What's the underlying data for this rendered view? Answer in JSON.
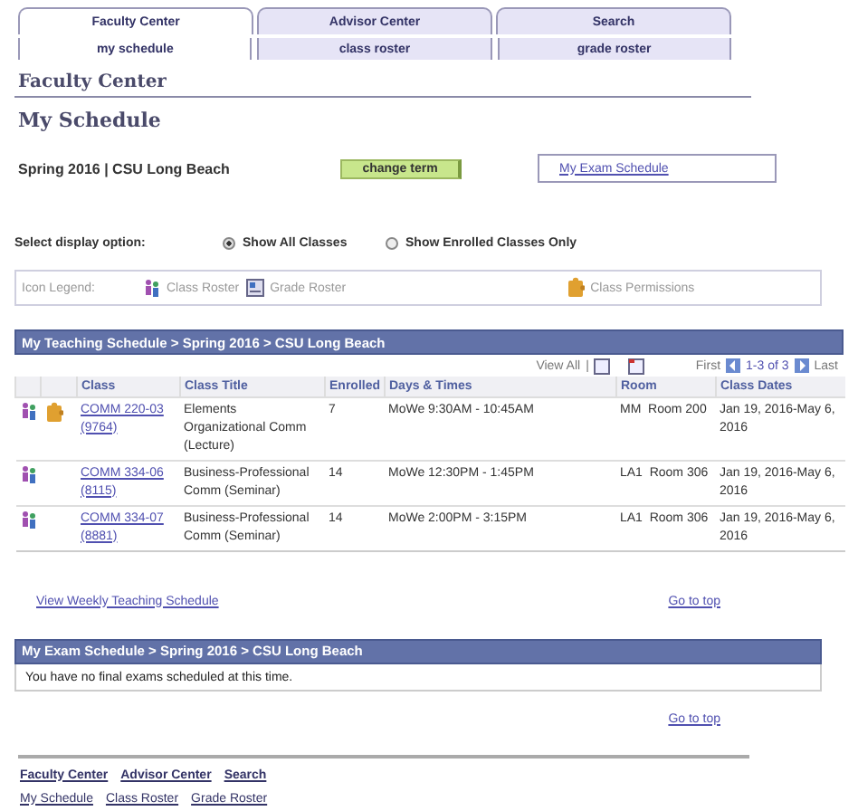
{
  "tabs": [
    {
      "label": "Faculty Center",
      "selected": true
    },
    {
      "label": "Advisor Center",
      "selected": false
    },
    {
      "label": "Search",
      "selected": false
    }
  ],
  "subtabs": [
    {
      "label": "my schedule",
      "selected": true
    },
    {
      "label": "class roster",
      "selected": false
    },
    {
      "label": "grade roster",
      "selected": false
    }
  ],
  "page_heading": "Faculty Center",
  "title": "My Schedule",
  "term": "Spring 2016 | CSU Long Beach",
  "change_term_button": "change term",
  "exam_schedule_link": "My Exam Schedule",
  "display_option": {
    "label": "Select display option:",
    "options": [
      {
        "label": "Show All Classes",
        "selected": true
      },
      {
        "label": "Show Enrolled Classes Only",
        "selected": false
      }
    ]
  },
  "legend": {
    "label": "Icon Legend:",
    "items": [
      {
        "kind": "roster",
        "label": "Class Roster"
      },
      {
        "kind": "grade",
        "label": "Grade Roster"
      },
      {
        "kind": "permission",
        "label": "Class Permissions"
      }
    ]
  },
  "teaching": {
    "header": "My Teaching Schedule > Spring 2016 > CSU Long Beach",
    "view_all": "View All",
    "separator": "|",
    "first": "First",
    "range": "1-3 of 3",
    "last": "Last",
    "columns": [
      "Class",
      "Class Title",
      "Enrolled",
      "Days & Times",
      "Room",
      "Class Dates"
    ],
    "rows": [
      {
        "permissions": true,
        "class": "COMM 220-03",
        "number": "(9764)",
        "title": "Elements Organizational Comm (Lecture)",
        "enrolled": "7",
        "days": "MoWe 9:30AM - 10:45AM",
        "room": "MM  Room 200",
        "dates": "Jan 19, 2016-May 6, 2016"
      },
      {
        "permissions": false,
        "class": "COMM 334-06",
        "number": "(8115)",
        "title": "Business-Professional Comm (Seminar)",
        "enrolled": "14",
        "days": "MoWe 12:30PM - 1:45PM",
        "room": "LA1  Room 306",
        "dates": "Jan 19, 2016-May 6, 2016"
      },
      {
        "permissions": false,
        "class": "COMM 334-07",
        "number": "(8881)",
        "title": "Business-Professional Comm (Seminar)",
        "enrolled": "14",
        "days": "MoWe 2:00PM - 3:15PM",
        "room": "LA1  Room 306",
        "dates": "Jan 19, 2016-May 6, 2016"
      }
    ]
  },
  "weekly_link": "View Weekly Teaching Schedule",
  "go_to_top": "Go to top",
  "exam": {
    "header": "My Exam Schedule > Spring 2016 > CSU Long Beach",
    "message": "You have no final exams scheduled at this time.",
    "go_to_top": "Go to top"
  },
  "footer": {
    "primary": [
      "Faculty Center",
      "Advisor Center",
      "Search"
    ],
    "secondary": [
      "My Schedule",
      "Class Roster",
      "Grade Roster"
    ]
  }
}
